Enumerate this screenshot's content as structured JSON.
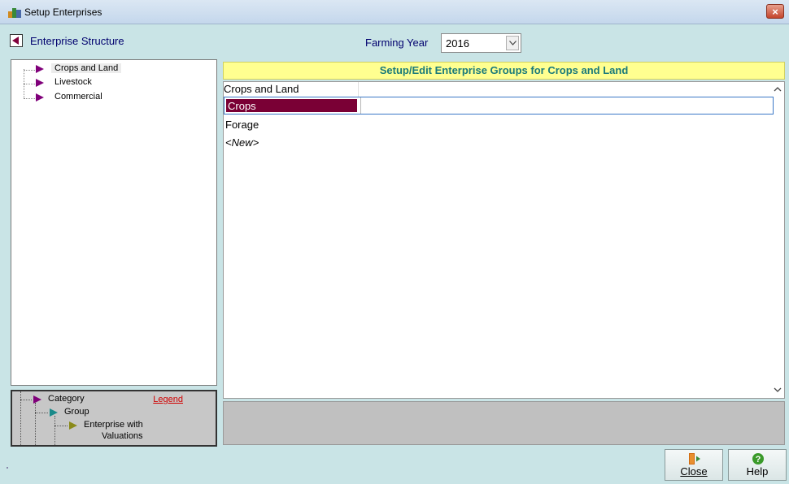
{
  "window": {
    "title": "Setup Enterprises",
    "close_glyph": "×"
  },
  "toolbar": {
    "enterprise_structure_label": "Enterprise Structure",
    "farming_year_label": "Farming Year",
    "farming_year_value": "2016"
  },
  "tree": {
    "items": [
      {
        "label": "Crops and Land",
        "selected": true
      },
      {
        "label": "Livestock",
        "selected": false
      },
      {
        "label": "Commercial",
        "selected": false
      }
    ]
  },
  "legend": {
    "title": "Legend",
    "category": "Category",
    "group": "Group",
    "enterprise_line1": "Enterprise with",
    "enterprise_line2": "Valuations",
    "colors": {
      "category": "#80007a",
      "group": "#1a8a8a",
      "enterprise": "#8a8a1a"
    }
  },
  "panel": {
    "header": "Setup/Edit Enterprise Groups for Crops and Land",
    "column_header": "Crops and Land",
    "rows": [
      {
        "label": "Crops",
        "selected": true
      },
      {
        "label": "Forage",
        "selected": false
      },
      {
        "label": "<New>",
        "selected": false
      }
    ]
  },
  "buttons": {
    "close_label": "Close",
    "help_label": "Help"
  },
  "colors": {
    "background": "#c9e4e6",
    "selection": "#7a0035",
    "header_bg": "#ffff90",
    "header_text": "#1a7a7a",
    "label_text": "#00006e"
  }
}
